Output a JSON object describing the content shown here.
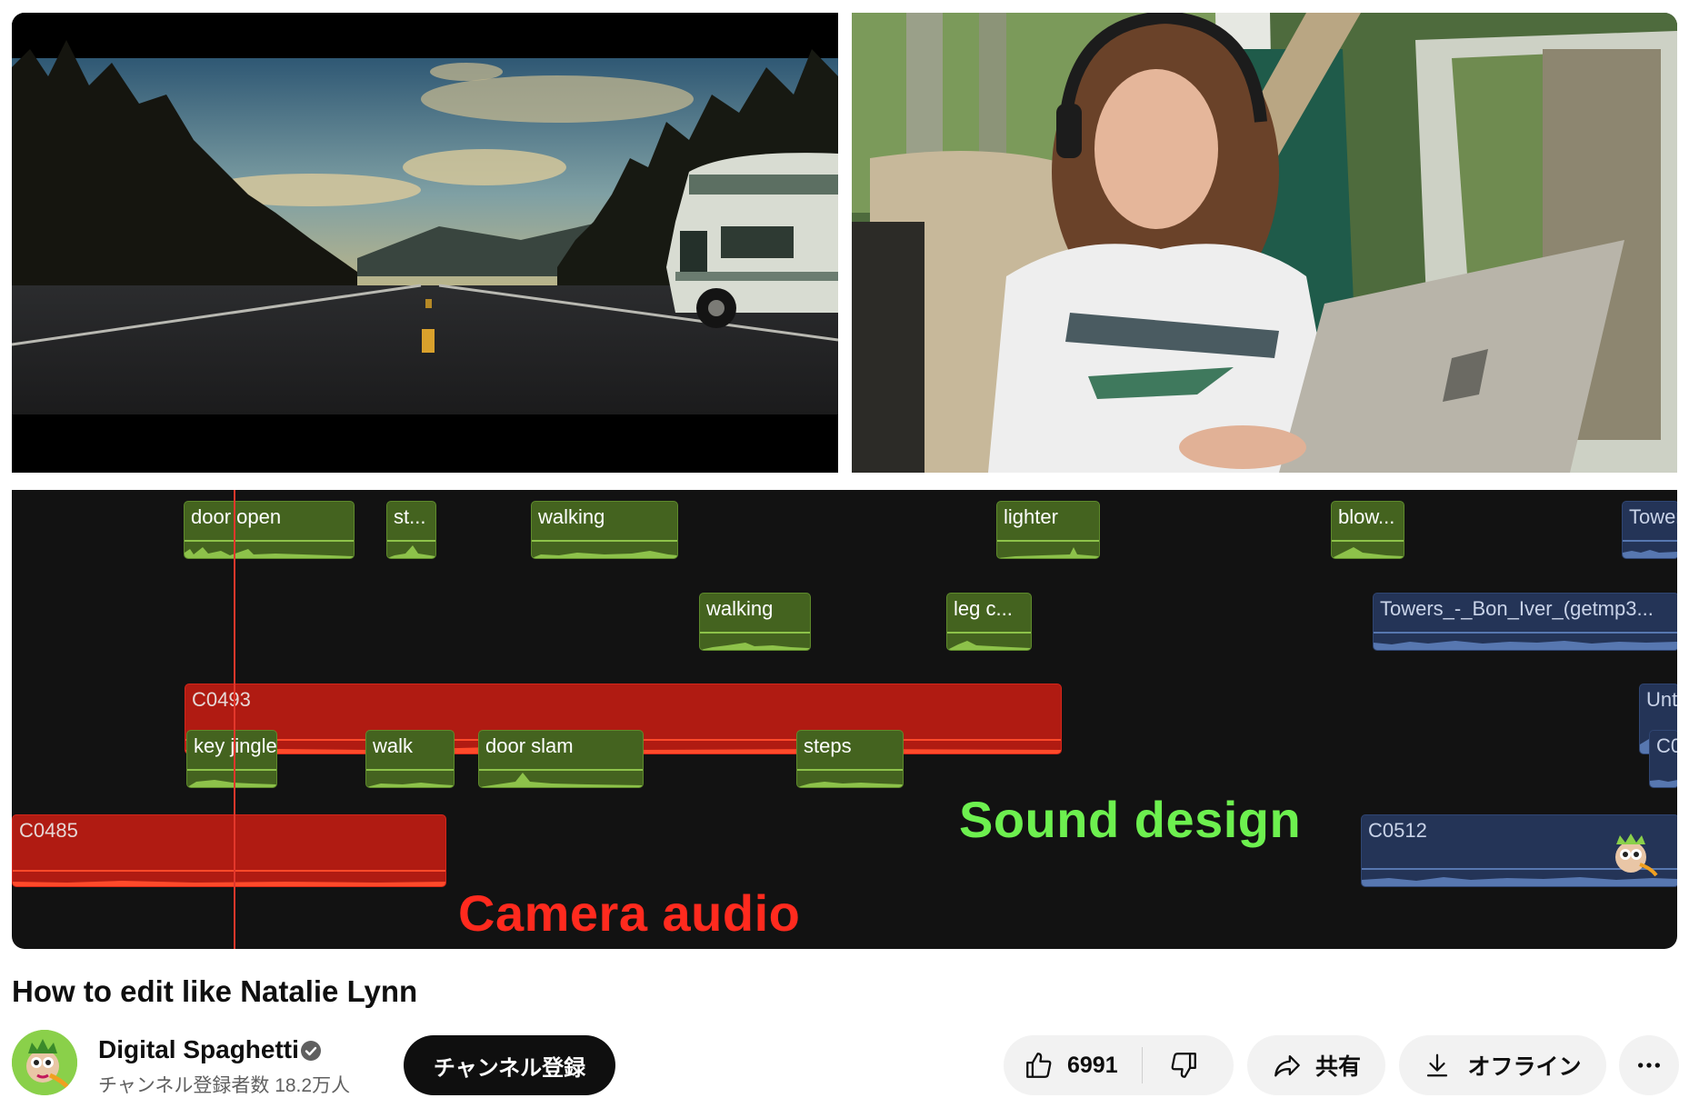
{
  "video": {
    "timeline": {
      "clips": {
        "door_open": "door open",
        "st": "st...",
        "walking_1": "walking",
        "lighter": "lighter",
        "blow": "blow...",
        "towers_short": "Towers",
        "walking_2": "walking",
        "leg": "leg c...",
        "towers_long": "Towers_-_Bon_Iver_(getmp3...",
        "c0493": "C0493",
        "untit": "Untit",
        "key_jingle": "key jingle",
        "walk": "walk",
        "door_slam": "door slam",
        "steps": "steps",
        "co": "C0",
        "c0485": "C0485",
        "c0512": "C0512"
      },
      "overlay_sound": "Sound design",
      "overlay_camera": "Camera audio",
      "colors": {
        "sfx": "#44631f",
        "camera": "#b01b12",
        "music": "#243457",
        "overlay_green": "#6df04f",
        "overlay_red": "#ff2a1e"
      }
    }
  },
  "title": "How to edit like Natalie Lynn",
  "channel": {
    "name": "Digital Spaghetti",
    "subscribers": "チャンネル登録者数 18.2万人",
    "subscribe_label": "チャンネル登録"
  },
  "actions": {
    "like_count": "6991",
    "share_label": "共有",
    "offline_label": "オフライン",
    "more_icon": "more-horizontal-icon"
  }
}
